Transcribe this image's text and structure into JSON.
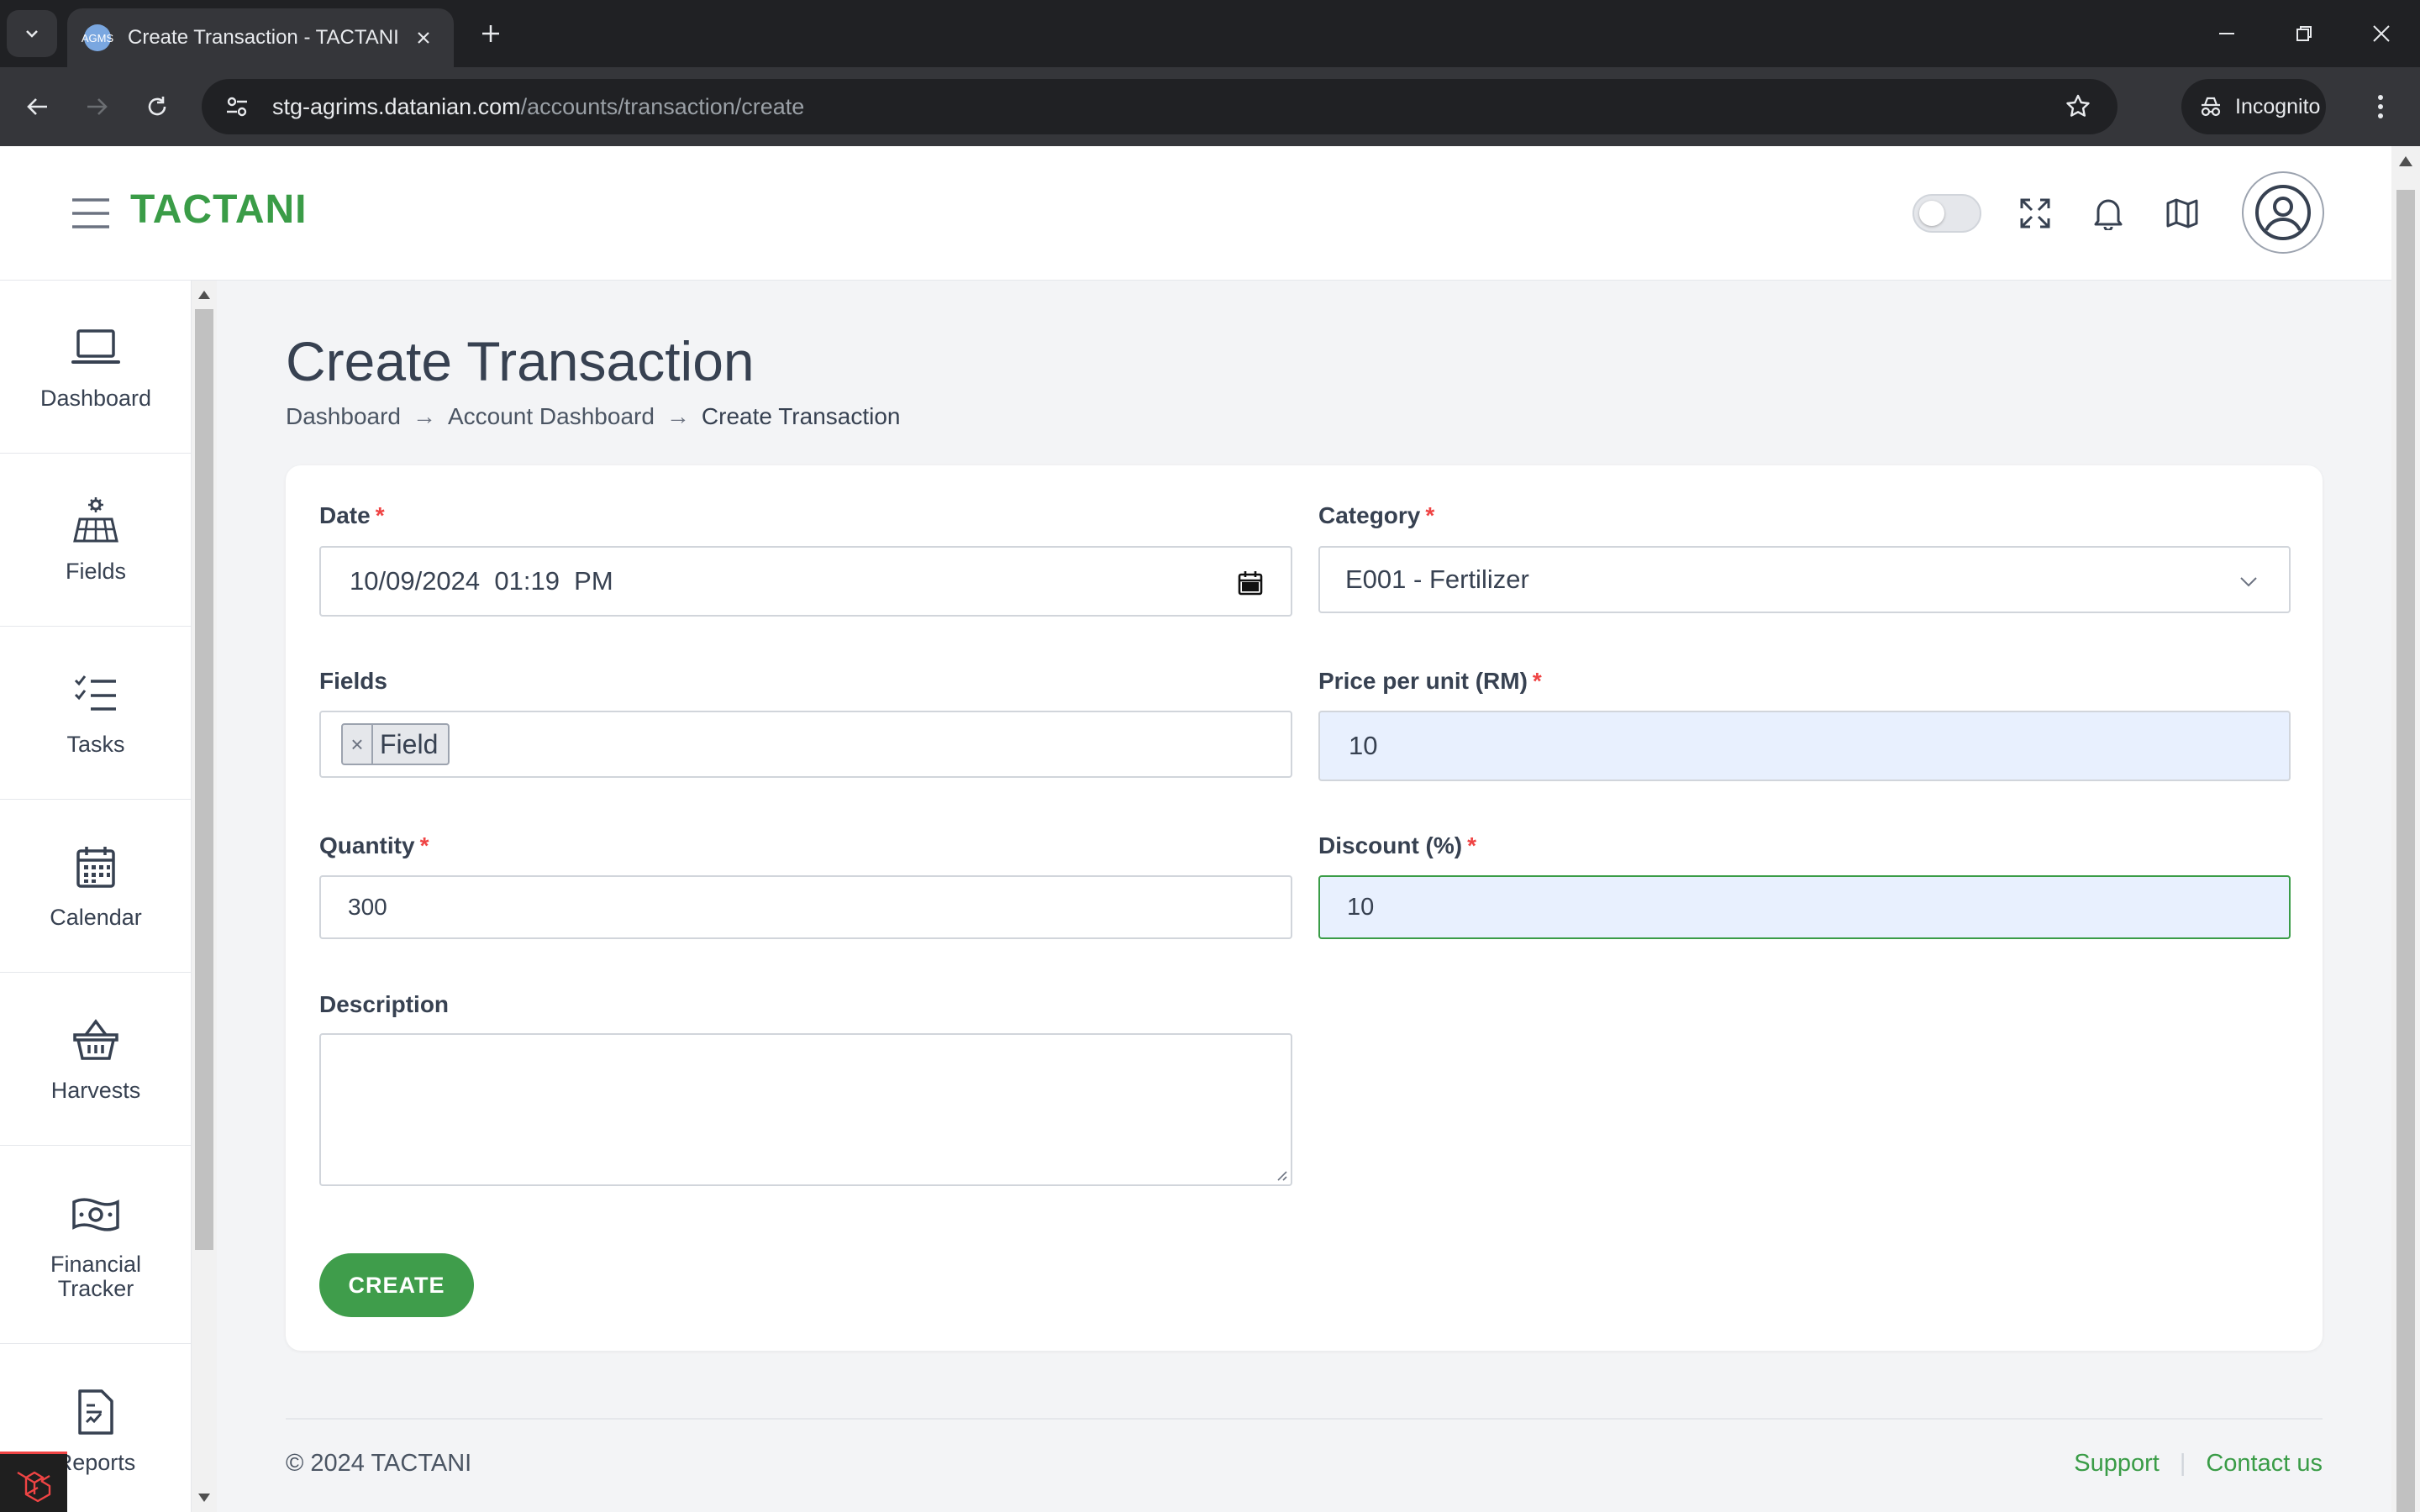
{
  "browser": {
    "tab_title": "Create Transaction - TACTANI",
    "favicon_text": "AGMS",
    "url_host": "stg-agrims.datanian.com",
    "url_path": "/accounts/transaction/create",
    "incognito_label": "Incognito"
  },
  "app": {
    "brand": "TACTANI"
  },
  "sidebar": {
    "items": [
      {
        "label": "Dashboard",
        "icon": "laptop-icon"
      },
      {
        "label": "Fields",
        "icon": "field-icon"
      },
      {
        "label": "Tasks",
        "icon": "tasks-icon"
      },
      {
        "label": "Calendar",
        "icon": "calendar-icon"
      },
      {
        "label": "Harvests",
        "icon": "basket-icon"
      },
      {
        "label": "Financial Tracker",
        "icon": "money-icon"
      },
      {
        "label": "Reports",
        "icon": "report-icon"
      }
    ]
  },
  "page": {
    "title": "Create Transaction",
    "breadcrumb": [
      "Dashboard",
      "Account Dashboard",
      "Create Transaction"
    ],
    "breadcrumb_separator": "→"
  },
  "form": {
    "date": {
      "label": "Date",
      "required": "*",
      "value": "10/09/2024  01:19  PM"
    },
    "category": {
      "label": "Category",
      "required": "*",
      "value": "E001 - Fertilizer"
    },
    "fields": {
      "label": "Fields",
      "chip": "Field",
      "chip_remove": "×"
    },
    "price": {
      "label": "Price per unit (RM)",
      "required": "*",
      "value": "10"
    },
    "quantity": {
      "label": "Quantity",
      "required": "*",
      "value": "300"
    },
    "discount": {
      "label": "Discount (%)",
      "required": "*",
      "value": "10"
    },
    "description": {
      "label": "Description",
      "value": ""
    },
    "submit_label": "CREATE"
  },
  "footer": {
    "copyright": "© 2024 TACTANI",
    "links": [
      "Support",
      "Contact us"
    ],
    "separator": "|"
  },
  "colors": {
    "brand_green": "#3a9c47",
    "required_red": "#ef4444",
    "autofill_blue": "#e8f0fe"
  }
}
